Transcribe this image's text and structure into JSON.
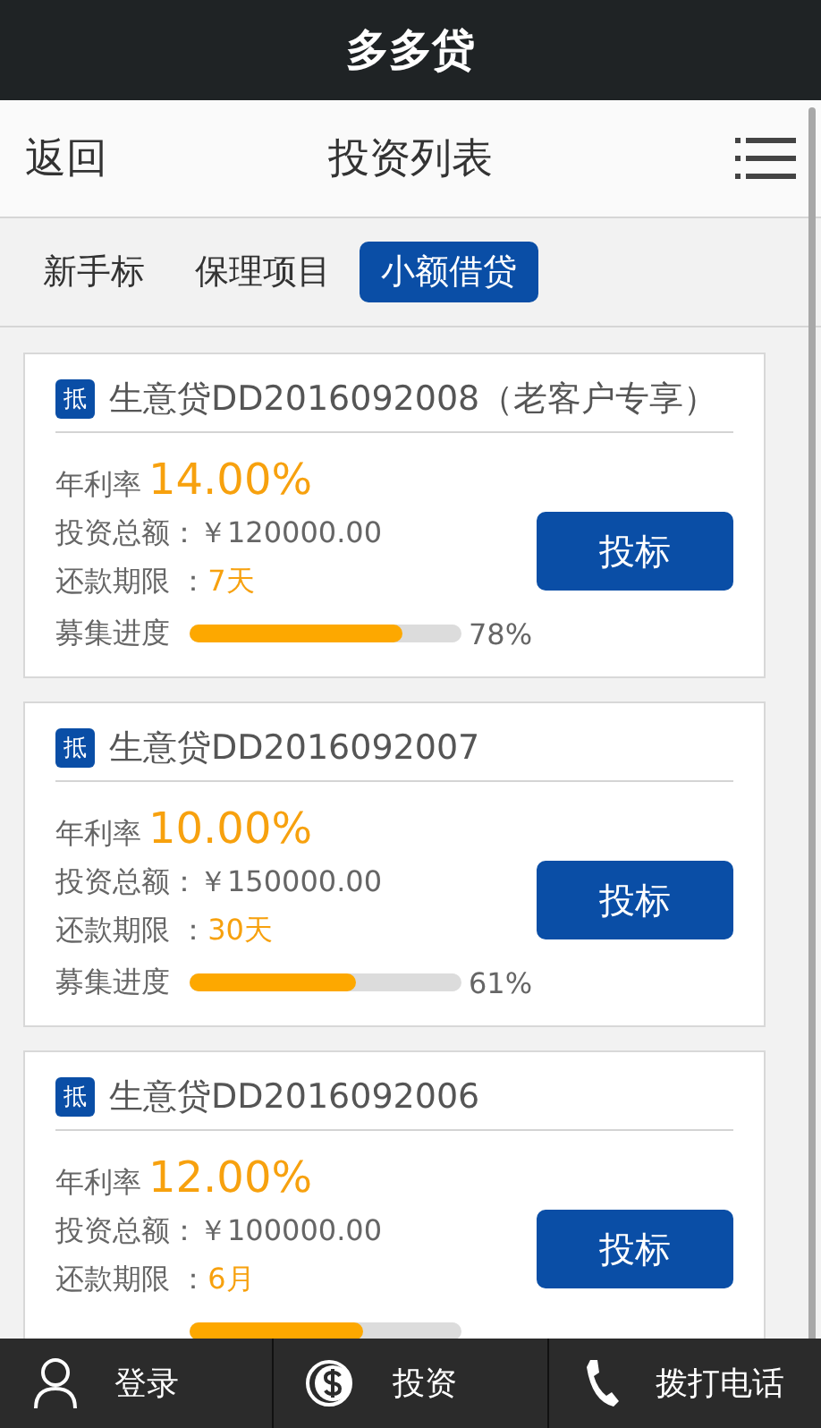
{
  "window": {
    "title": "多多贷"
  },
  "nav": {
    "back": "返回",
    "title": "投资列表"
  },
  "tabs": [
    {
      "label": "新手标",
      "selected": false
    },
    {
      "label": "保理项目",
      "selected": false
    },
    {
      "label": "小额借贷",
      "selected": true
    }
  ],
  "loans": [
    {
      "badge": "抵",
      "name": "生意贷DD2016092008（老客户专享）",
      "rate_label": "年利率",
      "rate": "14.00%",
      "amount_label": "投资总额：",
      "amount": "￥120000.00",
      "term_label": "还款期限 ：",
      "term": "7天",
      "progress_label": "募集进度",
      "level": 0.78,
      "reading": "78%",
      "button": "投标"
    },
    {
      "badge": "抵",
      "name": "生意贷DD2016092007",
      "rate_label": "年利率",
      "rate": "10.00%",
      "amount_label": "投资总额：",
      "amount": "￥150000.00",
      "term_label": "还款期限 ：",
      "term": "30天",
      "progress_label": "募集进度",
      "level": 0.61,
      "reading": "61%",
      "button": "投标"
    },
    {
      "badge": "抵",
      "name": "生意贷DD2016092006",
      "rate_label": "年利率",
      "rate": "12.00%",
      "amount_label": "投资总额：",
      "amount": "￥100000.00",
      "term_label": "还款期限 ：",
      "term": "6月",
      "level": 0.64,
      "button": "投标"
    }
  ],
  "bottom_bar": [
    {
      "kind": "user",
      "label": "登录"
    },
    {
      "kind": "coin",
      "label": "投资"
    },
    {
      "kind": "phone",
      "label": "拨打电话"
    }
  ]
}
